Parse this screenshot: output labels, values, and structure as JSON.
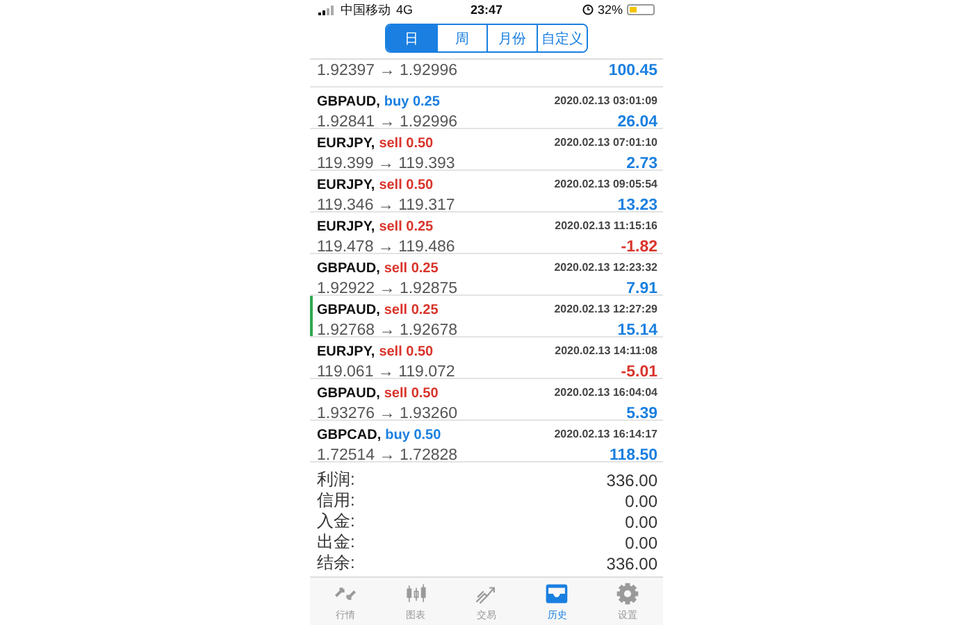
{
  "status_bar": {
    "carrier": "中国移动",
    "network": "4G",
    "time": "23:47",
    "battery_text": "32%",
    "battery": {
      "level": 0.32
    }
  },
  "period_tabs": [
    {
      "label": "日",
      "selected": true
    },
    {
      "label": "周",
      "selected": false
    },
    {
      "label": "月份",
      "selected": false
    },
    {
      "label": "自定义",
      "selected": false
    }
  ],
  "trades": [
    {
      "prices": "1.92397 → 1.92996",
      "profit": "100.45",
      "loss": false,
      "selected": false
    },
    {
      "symbol": "GBPAUD,",
      "side": "buy",
      "lots": "0.25",
      "time": "2020.02.13 03:01:09",
      "prices": "1.92841 → 1.92996",
      "profit": "26.04",
      "loss": false,
      "selected": false
    },
    {
      "symbol": "EURJPY,",
      "side": "sell",
      "lots": "0.50",
      "time": "2020.02.13 07:01:10",
      "prices": "119.399 → 119.393",
      "profit": "2.73",
      "loss": false,
      "selected": false
    },
    {
      "symbol": "EURJPY,",
      "side": "sell",
      "lots": "0.50",
      "time": "2020.02.13 09:05:54",
      "prices": "119.346 → 119.317",
      "profit": "13.23",
      "loss": false,
      "selected": false
    },
    {
      "symbol": "EURJPY,",
      "side": "sell",
      "lots": "0.25",
      "time": "2020.02.13 11:15:16",
      "prices": "119.478 → 119.486",
      "profit": "-1.82",
      "loss": true,
      "selected": false
    },
    {
      "symbol": "GBPAUD,",
      "side": "sell",
      "lots": "0.25",
      "time": "2020.02.13 12:23:32",
      "prices": "1.92922 → 1.92875",
      "profit": "7.91",
      "loss": false,
      "selected": false
    },
    {
      "symbol": "GBPAUD,",
      "side": "sell",
      "lots": "0.25",
      "time": "2020.02.13 12:27:29",
      "prices": "1.92768 → 1.92678",
      "profit": "15.14",
      "loss": false,
      "selected": true
    },
    {
      "symbol": "EURJPY,",
      "side": "sell",
      "lots": "0.50",
      "time": "2020.02.13 14:11:08",
      "prices": "119.061 → 119.072",
      "profit": "-5.01",
      "loss": true,
      "selected": false
    },
    {
      "symbol": "GBPAUD,",
      "side": "sell",
      "lots": "0.50",
      "time": "2020.02.13 16:04:04",
      "prices": "1.93276 → 1.93260",
      "profit": "5.39",
      "loss": false,
      "selected": false
    },
    {
      "symbol": "GBPCAD,",
      "side": "buy",
      "lots": "0.50",
      "time": "2020.02.13 16:14:17",
      "prices": "1.72514 → 1.72828",
      "profit": "118.50",
      "loss": false,
      "selected": false
    }
  ],
  "summary": [
    {
      "label": "利润:",
      "value": "336.00"
    },
    {
      "label": "信用:",
      "value": "0.00"
    },
    {
      "label": "入金:",
      "value": "0.00"
    },
    {
      "label": "出金:",
      "value": "0.00"
    },
    {
      "label": "结余:",
      "value": "336.00"
    }
  ],
  "tab_bar": [
    {
      "kind": "quotes",
      "label": "行情",
      "selected": false
    },
    {
      "kind": "chart",
      "label": "图表",
      "selected": false
    },
    {
      "kind": "trade",
      "label": "交易",
      "selected": false
    },
    {
      "kind": "history",
      "label": "历史",
      "selected": true
    },
    {
      "kind": "settings",
      "label": "设置",
      "selected": false
    }
  ]
}
